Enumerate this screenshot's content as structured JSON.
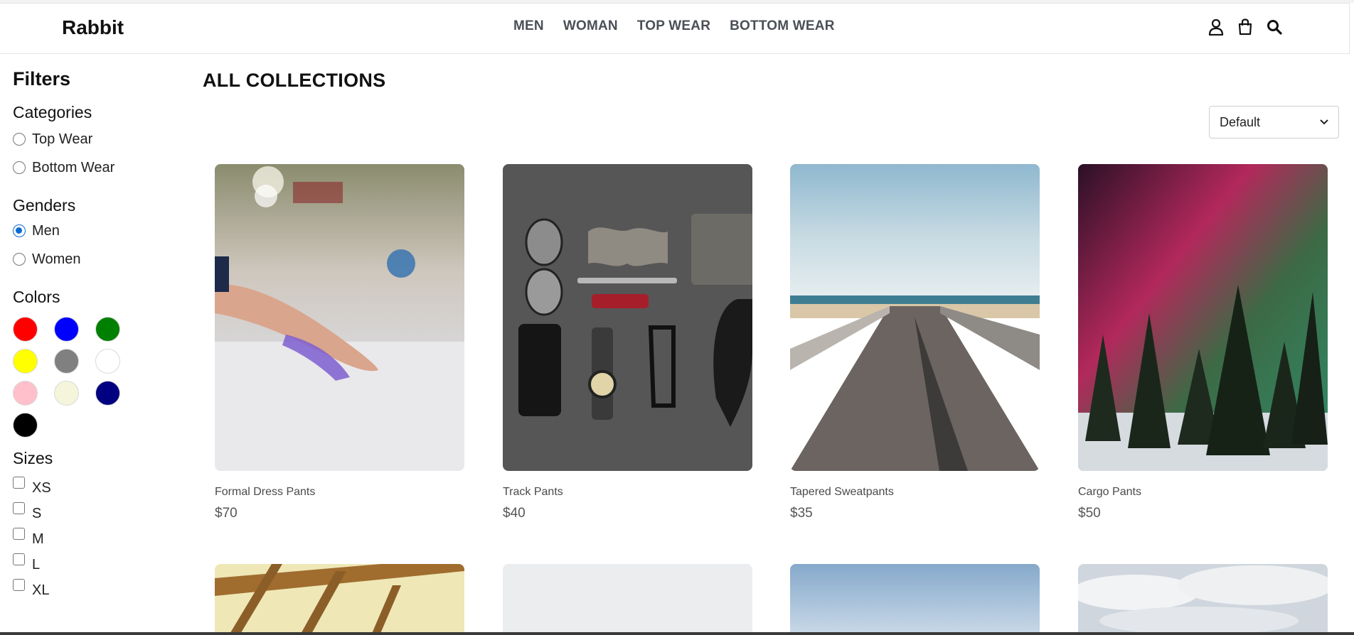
{
  "header": {
    "logo": "Rabbit",
    "nav": [
      "MEN",
      "WOMAN",
      "TOP WEAR",
      "BOTTOM WEAR"
    ],
    "icons": [
      "user-icon",
      "bag-icon",
      "search-icon"
    ]
  },
  "sidebar": {
    "title": "Filters",
    "categories": {
      "title": "Categories",
      "options": [
        "Top Wear",
        "Bottom Wear"
      ]
    },
    "genders": {
      "title": "Genders",
      "options": [
        "Men",
        "Women"
      ],
      "selected": "Men"
    },
    "colors": {
      "title": "Colors",
      "swatches": [
        "#ff0000",
        "#0000ff",
        "#008000",
        "#ffff00",
        "#808080",
        "#ffffff",
        "#ffc0cb",
        "#f5f5dc",
        "#000080",
        "#000000"
      ]
    },
    "sizes": {
      "title": "Sizes",
      "options": [
        "XS",
        "S",
        "M",
        "L",
        "XL"
      ]
    }
  },
  "main": {
    "title": "ALL COLLECTIONS",
    "sort": {
      "selected": "Default"
    },
    "products": [
      {
        "name": "Formal Dress Pants",
        "price": "$70"
      },
      {
        "name": "Track Pants",
        "price": "$40"
      },
      {
        "name": "Tapered Sweatpants",
        "price": "$35"
      },
      {
        "name": "Cargo Pants",
        "price": "$50"
      }
    ]
  }
}
